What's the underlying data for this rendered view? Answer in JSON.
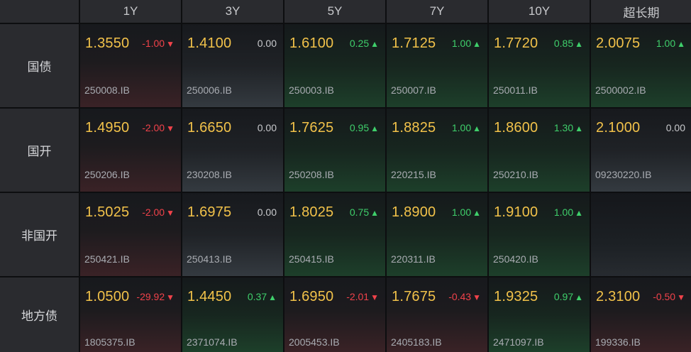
{
  "headers": [
    "1Y",
    "3Y",
    "5Y",
    "7Y",
    "10Y",
    "超长期"
  ],
  "rows": [
    {
      "label": "国债",
      "cells": [
        {
          "yield": "1.3550",
          "change": "-1.00",
          "dir": "down",
          "code": "250008.IB"
        },
        {
          "yield": "1.4100",
          "change": "0.00",
          "dir": "flat",
          "code": "250006.IB"
        },
        {
          "yield": "1.6100",
          "change": "0.25",
          "dir": "up",
          "code": "250003.IB"
        },
        {
          "yield": "1.7125",
          "change": "1.00",
          "dir": "up",
          "code": "250007.IB"
        },
        {
          "yield": "1.7720",
          "change": "0.85",
          "dir": "up",
          "code": "250011.IB"
        },
        {
          "yield": "2.0075",
          "change": "1.00",
          "dir": "up",
          "code": "2500002.IB"
        }
      ]
    },
    {
      "label": "国开",
      "cells": [
        {
          "yield": "1.4950",
          "change": "-2.00",
          "dir": "down",
          "code": "250206.IB"
        },
        {
          "yield": "1.6650",
          "change": "0.00",
          "dir": "flat",
          "code": "230208.IB"
        },
        {
          "yield": "1.7625",
          "change": "0.95",
          "dir": "up",
          "code": "250208.IB"
        },
        {
          "yield": "1.8825",
          "change": "1.00",
          "dir": "up",
          "code": "220215.IB"
        },
        {
          "yield": "1.8600",
          "change": "1.30",
          "dir": "up",
          "code": "250210.IB"
        },
        {
          "yield": "2.1000",
          "change": "0.00",
          "dir": "flat",
          "code": "09230220.IB"
        }
      ]
    },
    {
      "label": "非国开",
      "cells": [
        {
          "yield": "1.5025",
          "change": "-2.00",
          "dir": "down",
          "code": "250421.IB"
        },
        {
          "yield": "1.6975",
          "change": "0.00",
          "dir": "flat",
          "code": "250413.IB"
        },
        {
          "yield": "1.8025",
          "change": "0.75",
          "dir": "up",
          "code": "250415.IB"
        },
        {
          "yield": "1.8900",
          "change": "1.00",
          "dir": "up",
          "code": "220311.IB"
        },
        {
          "yield": "1.9100",
          "change": "1.00",
          "dir": "up",
          "code": "250420.IB"
        },
        null
      ]
    },
    {
      "label": "地方债",
      "cells": [
        {
          "yield": "1.0500",
          "change": "-29.92",
          "dir": "down",
          "code": "1805375.IB"
        },
        {
          "yield": "1.4450",
          "change": "0.37",
          "dir": "up",
          "code": "2371074.IB"
        },
        {
          "yield": "1.6950",
          "change": "-2.01",
          "dir": "down",
          "code": "2005453.IB"
        },
        {
          "yield": "1.7675",
          "change": "-0.43",
          "dir": "down",
          "code": "2405183.IB"
        },
        {
          "yield": "1.9325",
          "change": "0.97",
          "dir": "up",
          "code": "2471097.IB"
        },
        {
          "yield": "2.3100",
          "change": "-0.50",
          "dir": "down",
          "code": "199336.IB"
        }
      ]
    }
  ],
  "colors": {
    "yield": "#f2c24a",
    "down": "#f0424a",
    "up": "#3fcf6b",
    "flat": "#c8c9cc"
  },
  "icons": {
    "down": "arrow-down-icon",
    "up": "arrow-up-icon"
  }
}
